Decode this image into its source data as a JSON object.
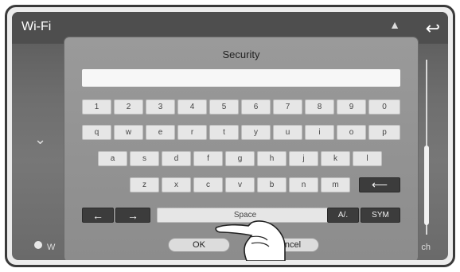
{
  "screen": {
    "title": "Wi-Fi",
    "bottom_left_text": "W",
    "bottom_right_text": "ch"
  },
  "dialog": {
    "title": "Security",
    "input_value": ""
  },
  "keyboard": {
    "row1": [
      "1",
      "2",
      "3",
      "4",
      "5",
      "6",
      "7",
      "8",
      "9",
      "0"
    ],
    "row2": [
      "q",
      "w",
      "e",
      "r",
      "t",
      "y",
      "u",
      "i",
      "o",
      "p"
    ],
    "row3": [
      "a",
      "s",
      "d",
      "f",
      "g",
      "h",
      "j",
      "k",
      "l"
    ],
    "row4": [
      "z",
      "x",
      "c",
      "v",
      "b",
      "n",
      "m"
    ],
    "left_arrow": "←",
    "right_arrow": "→",
    "space_label": "Space",
    "case_label": "A/.",
    "sym_label": "SYM",
    "backspace": "⟵"
  },
  "buttons": {
    "ok_label": "OK",
    "cancel_label": "Cancel"
  }
}
